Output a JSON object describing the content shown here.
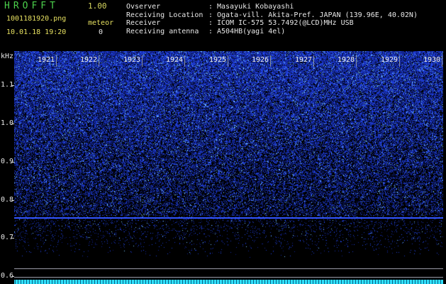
{
  "header": {
    "app_title": "HROFFT",
    "version": "1.00",
    "filename": "1001181920.png",
    "datetime": "10.01.18 19:20",
    "meteor_label": "meteor",
    "meteor_count": "0",
    "info_rows": [
      {
        "key": "Ovserver",
        "value": "Masayuki Kobayashi"
      },
      {
        "key": "Receiving Location",
        "value": "Ogata-vill. Akita-Pref. JAPAN (139.96E, 40.02N)"
      },
      {
        "key": "Receiver",
        "value": "ICOM IC-575 53.7492(@LCD)MHz USB"
      },
      {
        "key": "Receiving antenna",
        "value": "A504HB(yagi 4el)"
      }
    ]
  },
  "chart_data": {
    "type": "heatmap",
    "ylabel": "kHz",
    "y_ticks": [
      "1.1",
      "1.0",
      "0.9",
      "0.8",
      "0.7",
      "0.6"
    ],
    "x_ticks": [
      "1921",
      "1922",
      "1923",
      "1924",
      "1925",
      "1926",
      "1927",
      "1928",
      "1929",
      "1930"
    ],
    "ylim": [
      0.58,
      1.19
    ],
    "colors": {
      "signal_line": "#3355ff",
      "low_noise": "#1a2bd6",
      "baseline": "#30e0ff"
    }
  }
}
